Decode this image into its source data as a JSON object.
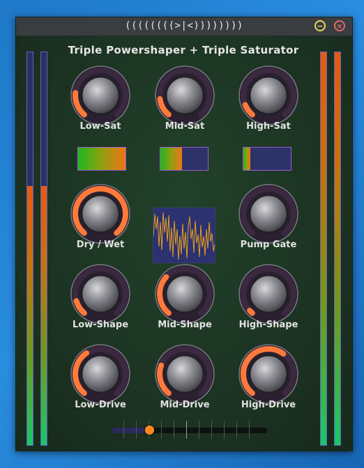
{
  "window": {
    "title": "((((((((>|<))))))))",
    "minimize_label": "−",
    "close_label": "×"
  },
  "plugin": {
    "heading": "Triple Powershaper + Triple Saturator"
  },
  "colors": {
    "knob_arc": "#ff7a3a",
    "knob_ring_bg": "#3b2a3f",
    "meter_border": "#6a5fc2",
    "panel_bg": "#1f3423"
  },
  "meters": {
    "left_a": 0.66,
    "left_b": 0.66,
    "right_a": 1.0,
    "right_b": 1.0
  },
  "knobs": [
    {
      "label": "Low-Sat",
      "value": 0.2
    },
    {
      "label": "Mid-Sat",
      "value": 0.15
    },
    {
      "label": "High-Sat",
      "value": 0.1
    },
    {
      "label": "Dry / Wet",
      "value": 1.0
    },
    {
      "label": "Pump Gate",
      "value": 0.0
    },
    {
      "label": "Low-Shape",
      "value": 0.12
    },
    {
      "label": "Mid-Shape",
      "value": 0.33
    },
    {
      "label": "High-Shape",
      "value": 0.03
    },
    {
      "label": "Low-Drive",
      "value": 0.38
    },
    {
      "label": "Mid-Drive",
      "value": 0.25
    },
    {
      "label": "High-Drive",
      "value": 0.63
    }
  ],
  "sat_meters": {
    "low": 1.0,
    "mid": 0.46,
    "high": 0.14
  },
  "slider": {
    "value": 0.24
  },
  "icons": {
    "minimize": "minimize-icon",
    "close": "close-icon"
  }
}
